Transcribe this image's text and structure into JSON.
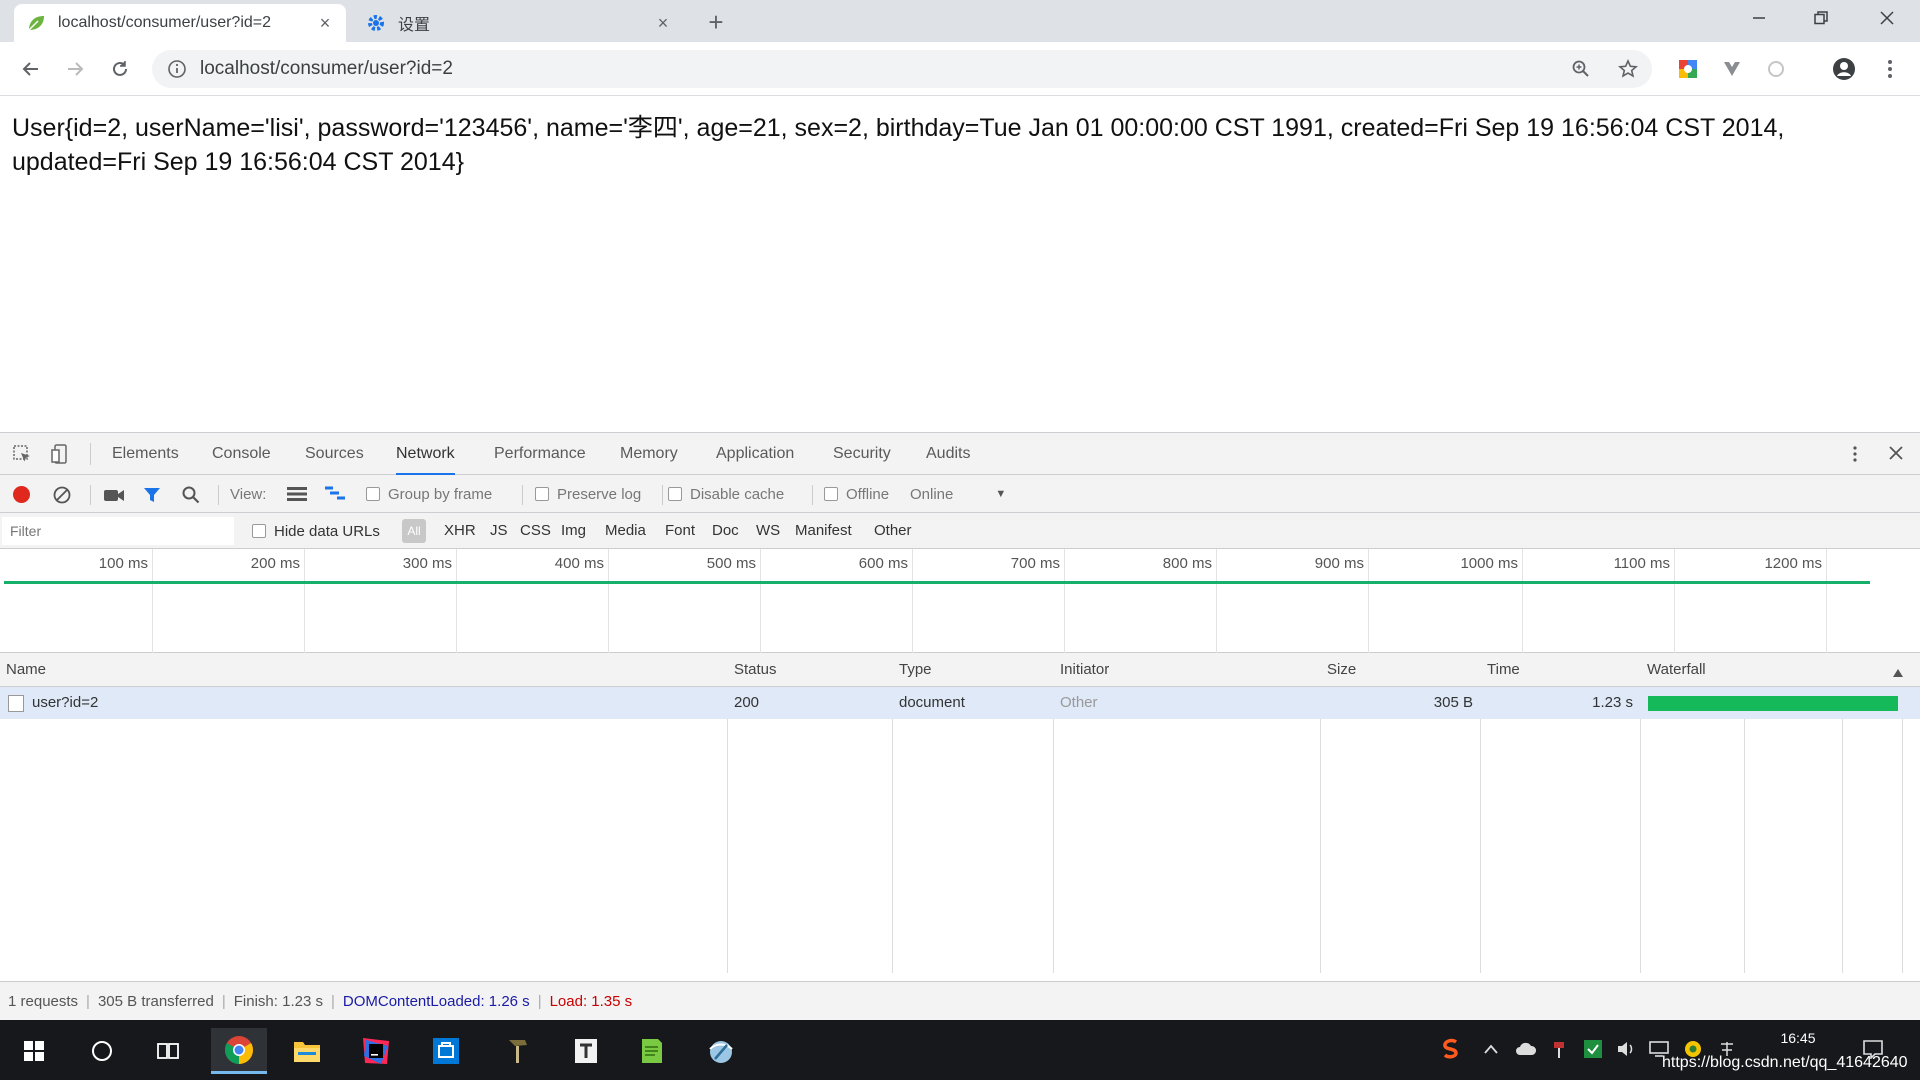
{
  "browser": {
    "tabs": [
      {
        "title": "localhost/consumer/user?id=2",
        "close": "×",
        "favicon": "leaf-icon"
      },
      {
        "title": "设置",
        "close": "×",
        "favicon": "gear-icon"
      }
    ],
    "new_tab": "+",
    "url": "localhost/consumer/user?id=2"
  },
  "page": {
    "text": "User{id=2, userName='lisi', password='123456', name='李四', age=21, sex=2, birthday=Tue Jan 01 00:00:00 CST 1991, created=Fri Sep 19 16:56:04 CST 2014, updated=Fri Sep 19 16:56:04 CST 2014}"
  },
  "devtools": {
    "tabs": [
      "Elements",
      "Console",
      "Sources",
      "Network",
      "Performance",
      "Memory",
      "Application",
      "Security",
      "Audits"
    ],
    "active_tab": "Network",
    "toolbar": {
      "view_label": "View:",
      "group_by_frame": "Group by frame",
      "preserve_log": "Preserve log",
      "disable_cache": "Disable cache",
      "offline": "Offline",
      "throttle": "Online"
    },
    "filter": {
      "placeholder": "Filter",
      "hide_data_urls": "Hide data URLs",
      "types": [
        "All",
        "XHR",
        "JS",
        "CSS",
        "Img",
        "Media",
        "Font",
        "Doc",
        "WS",
        "Manifest",
        "Other"
      ]
    },
    "overview": {
      "ticks": [
        "100 ms",
        "200 ms",
        "300 ms",
        "400 ms",
        "500 ms",
        "600 ms",
        "700 ms",
        "800 ms",
        "900 ms",
        "1000 ms",
        "1100 ms",
        "1200 ms"
      ]
    },
    "table": {
      "columns": [
        "Name",
        "Status",
        "Type",
        "Initiator",
        "Size",
        "Time",
        "Waterfall"
      ],
      "rows": [
        {
          "name": "user?id=2",
          "status": "200",
          "type": "document",
          "initiator": "Other",
          "size": "305 B",
          "time": "1.23 s"
        }
      ]
    },
    "status": {
      "requests": "1 requests",
      "transferred": "305 B transferred",
      "finish": "Finish: 1.23 s",
      "dom_content_loaded": "DOMContentLoaded: 1.26 s",
      "load": "Load: 1.35 s",
      "dcl_color": "#1a1aa6",
      "load_color": "#c80000"
    }
  },
  "taskbar": {
    "clock": "16:45",
    "watermark": "https://blog.csdn.net/qq_41642640"
  },
  "colors": {
    "accent": "#1a73e8",
    "record": "#e0281e",
    "waterfall": "#16b95a"
  }
}
